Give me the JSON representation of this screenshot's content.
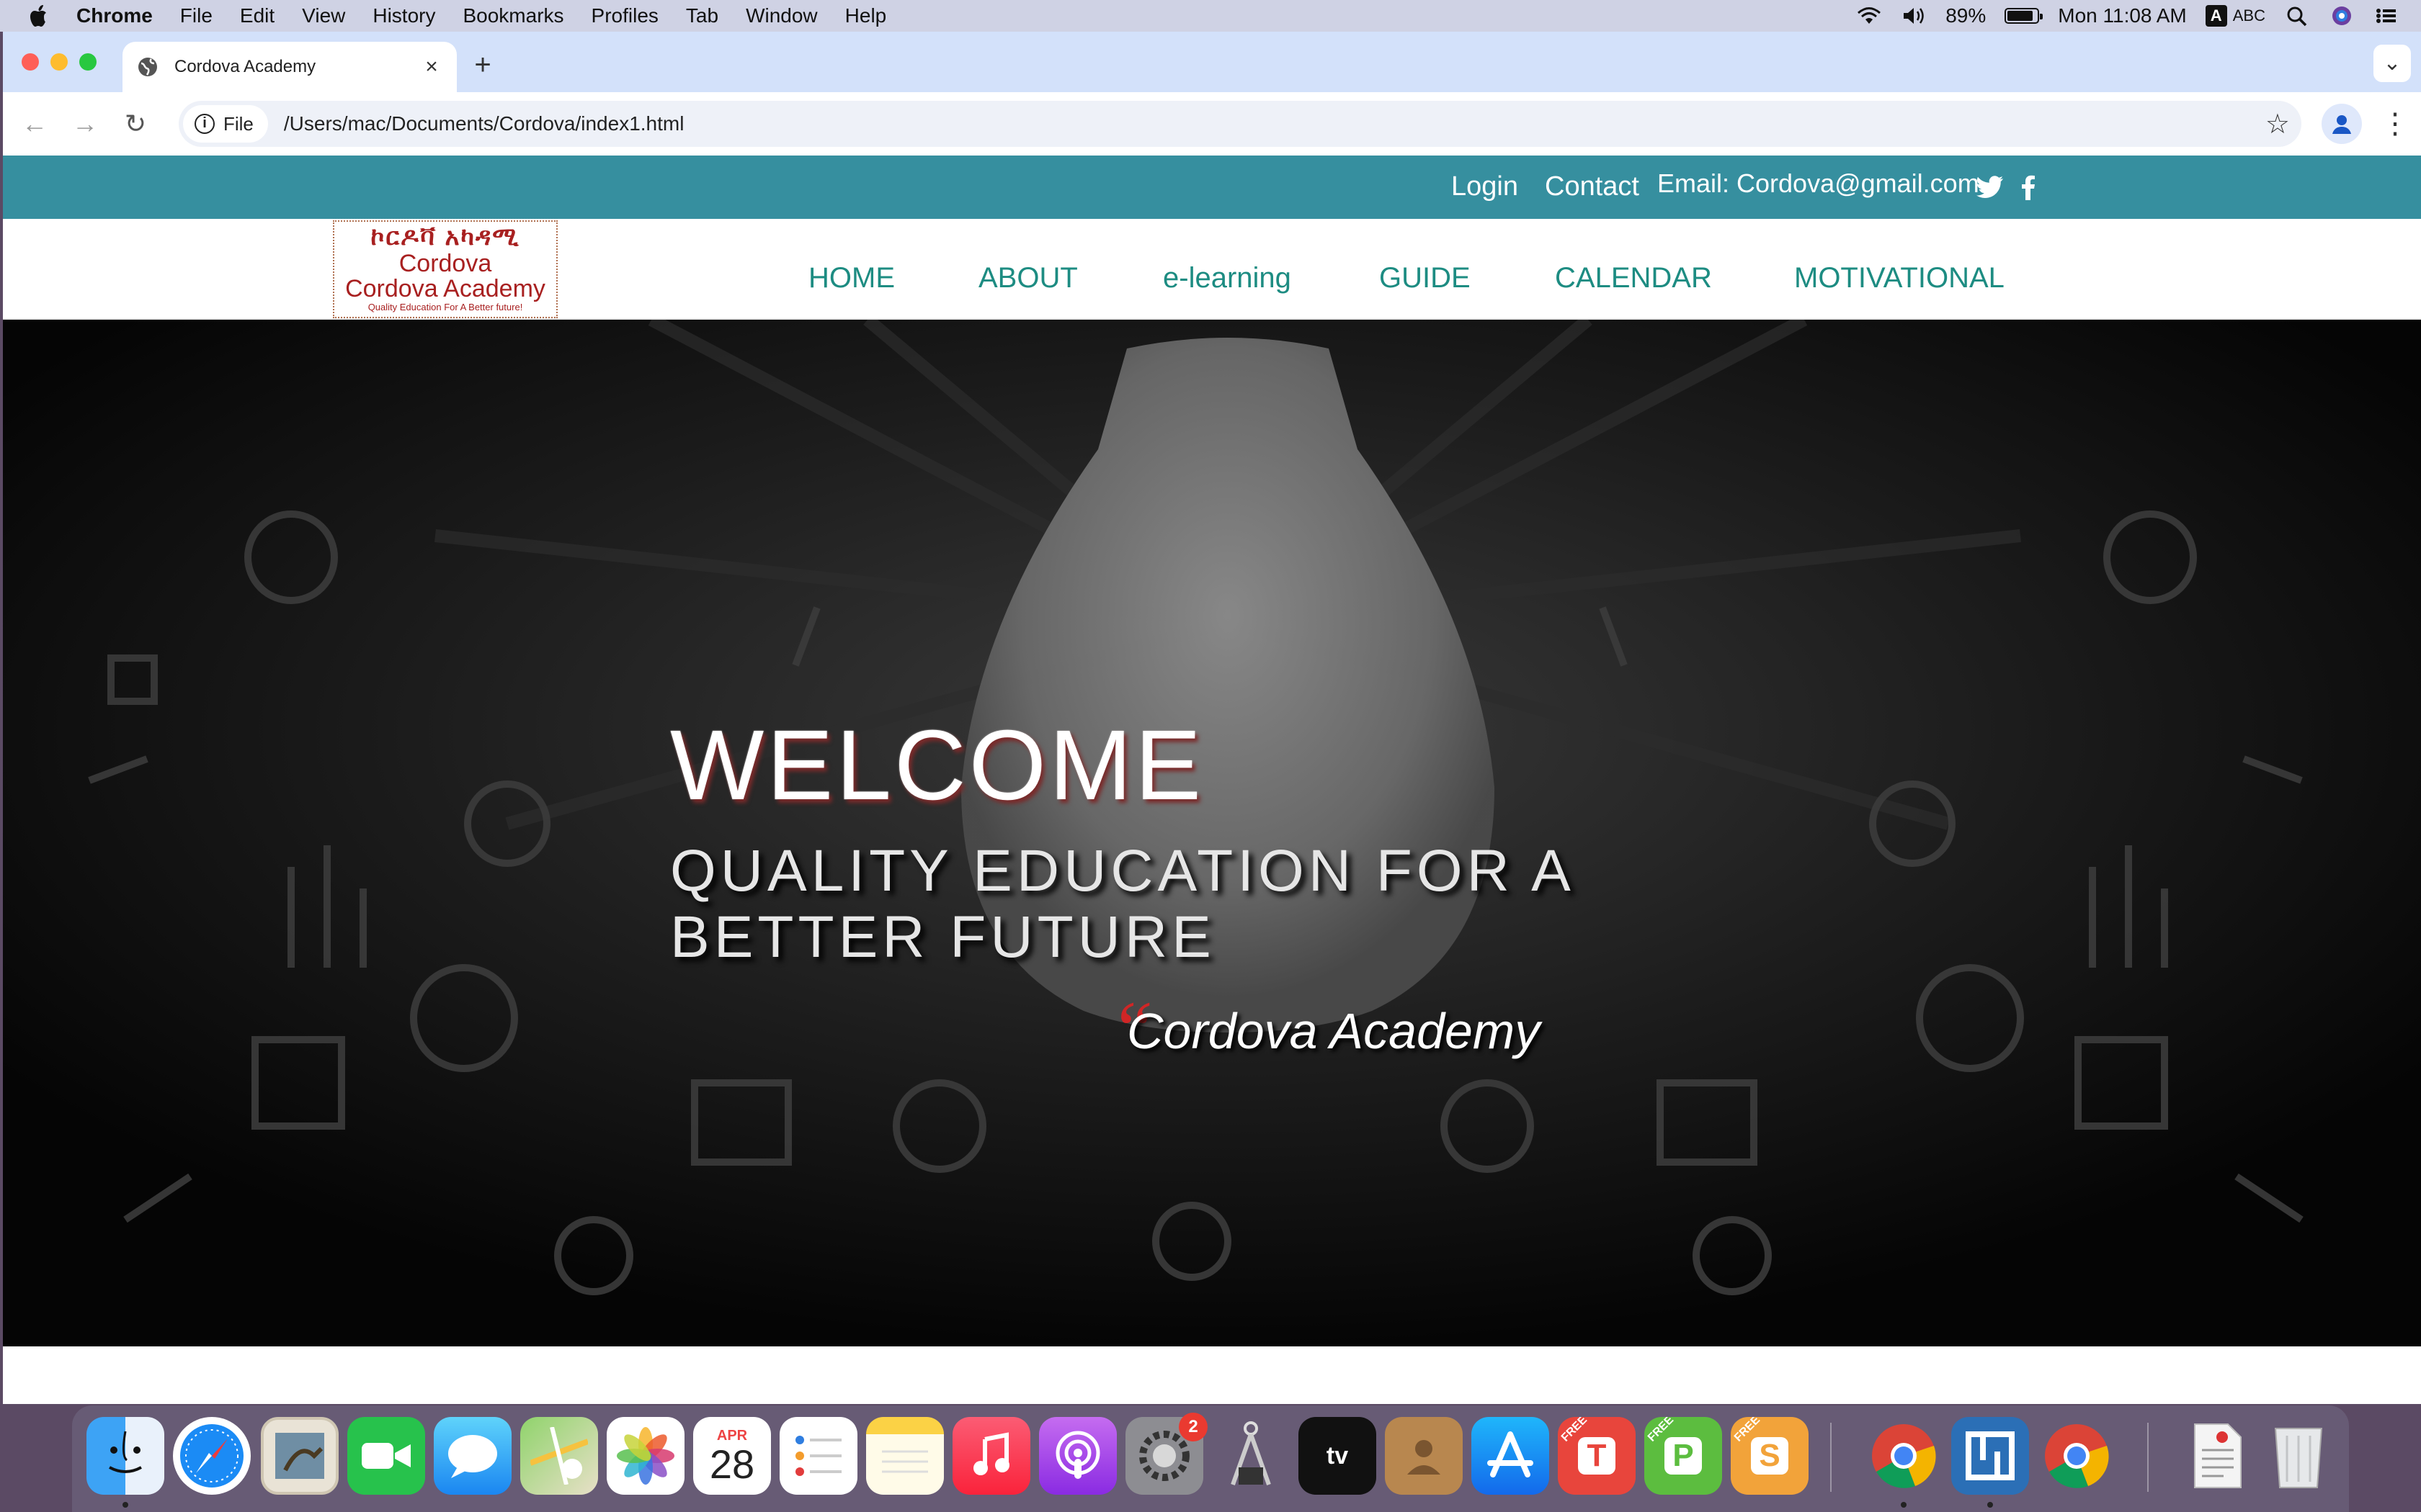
{
  "menubar": {
    "app_name": "Chrome",
    "items": [
      "File",
      "Edit",
      "View",
      "History",
      "Bookmarks",
      "Profiles",
      "Tab",
      "Window",
      "Help"
    ],
    "battery": "89%",
    "clock": "Mon 11:08 AM",
    "input_source": "ABC",
    "input_key": "A"
  },
  "browser": {
    "tab_title": "Cordova Academy",
    "scheme_chip": "File",
    "url": "/Users/mac/Documents/Cordova/index1.html"
  },
  "site": {
    "topbar": {
      "login": "Login",
      "contact": "Contact",
      "email": "Email: Cordova@gmail.com"
    },
    "logo": {
      "amharic": "ኮርዶቫ አካዳሚ",
      "line1": "Cordova",
      "line2": "Cordova Academy",
      "line3": "Quality Education For A Better future!"
    },
    "nav": [
      "HOME",
      "ABOUT",
      "e-learning",
      "GUIDE",
      "CALENDAR",
      "MOTIVATIONAL"
    ],
    "hero": {
      "welcome": "WELCOME",
      "tagline_line1": "QUALITY EDUCATION FOR A",
      "tagline_line2": "BETTER FUTURE",
      "quote_mark": "“",
      "signature": "Cordova Academy"
    }
  },
  "dock": {
    "calendar_month": "APR",
    "calendar_day": "28",
    "system_settings_badge": "2",
    "tv_label": "tv",
    "apps": [
      "finder",
      "safari",
      "preview",
      "facetime",
      "messages",
      "maps",
      "photos",
      "calendar",
      "reminders",
      "notes",
      "music",
      "podcasts",
      "system-settings",
      "instruments",
      "apple-tv",
      "contacts",
      "app-store",
      "toolbox-t",
      "toolbox-p",
      "toolbox-s",
      "chrome",
      "wrap",
      "chrome",
      "document",
      "trash"
    ],
    "free_label": "FREE"
  },
  "colors": {
    "topbar": "#368f9f",
    "nav_link": "#1d8c82",
    "logo_red": "#a82020",
    "hero_bg": "#060606"
  }
}
